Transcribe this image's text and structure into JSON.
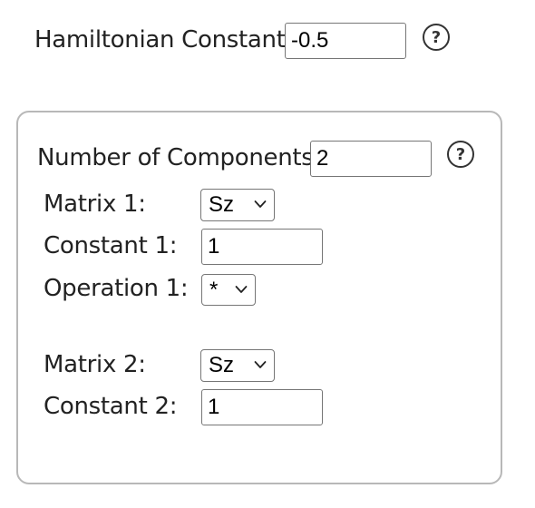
{
  "hamiltonian": {
    "label": "Hamiltonian Constant",
    "value": "-0.5",
    "help_glyph": "?"
  },
  "components": {
    "label": "Number of Components",
    "value": "2",
    "help_glyph": "?",
    "rows": [
      {
        "matrix_label": "Matrix 1:",
        "matrix_value": "Sz",
        "constant_label": "Constant 1:",
        "constant_value": "1",
        "operation_label": "Operation 1:",
        "operation_value": "*"
      },
      {
        "matrix_label": "Matrix 2:",
        "matrix_value": "Sz",
        "constant_label": "Constant 2:",
        "constant_value": "1"
      }
    ]
  },
  "icons": {
    "help": "help-circle-icon",
    "dropdown": "chevron-down-icon"
  }
}
